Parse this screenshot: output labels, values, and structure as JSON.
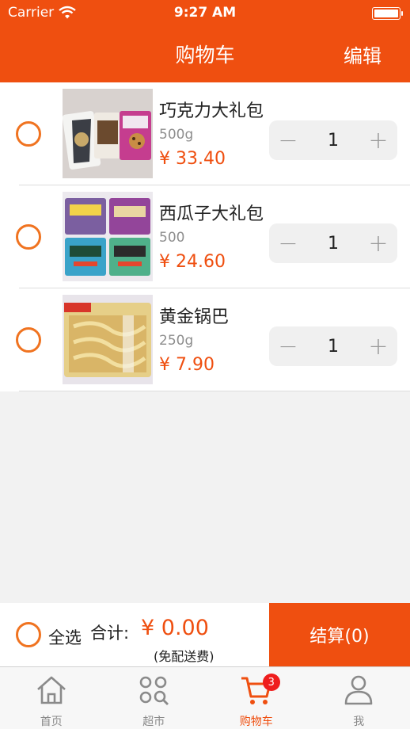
{
  "status_bar": {
    "carrier": "Carrier",
    "time": "9:27 AM"
  },
  "nav": {
    "title": "购物车",
    "edit_label": "编辑"
  },
  "items": [
    {
      "name": "巧克力大礼包",
      "weight": "500g",
      "price": "¥ 33.40",
      "quantity": "1"
    },
    {
      "name": "西瓜子大礼包",
      "weight": "500",
      "price": "¥ 24.60",
      "quantity": "1"
    },
    {
      "name": "黄金锅巴",
      "weight": "250g",
      "price": "¥ 7.90",
      "quantity": "1"
    }
  ],
  "stepper": {
    "minus": "−",
    "plus": "+"
  },
  "summary": {
    "select_all_label": "全选",
    "total_label": "合计:",
    "total_value": "¥ 0.00",
    "shipping_note": "(免配送费)",
    "checkout_label": "结算(0)"
  },
  "tabs": [
    {
      "label": "首页",
      "icon": "home-icon",
      "active": false
    },
    {
      "label": "超市",
      "icon": "grid-search-icon",
      "active": false
    },
    {
      "label": "购物车",
      "icon": "cart-icon",
      "active": true,
      "badge": "3"
    },
    {
      "label": "我",
      "icon": "person-icon",
      "active": false
    }
  ],
  "colors": {
    "accent": "#ef4f10",
    "radio": "#f07320",
    "badge": "#ef1d1d"
  }
}
